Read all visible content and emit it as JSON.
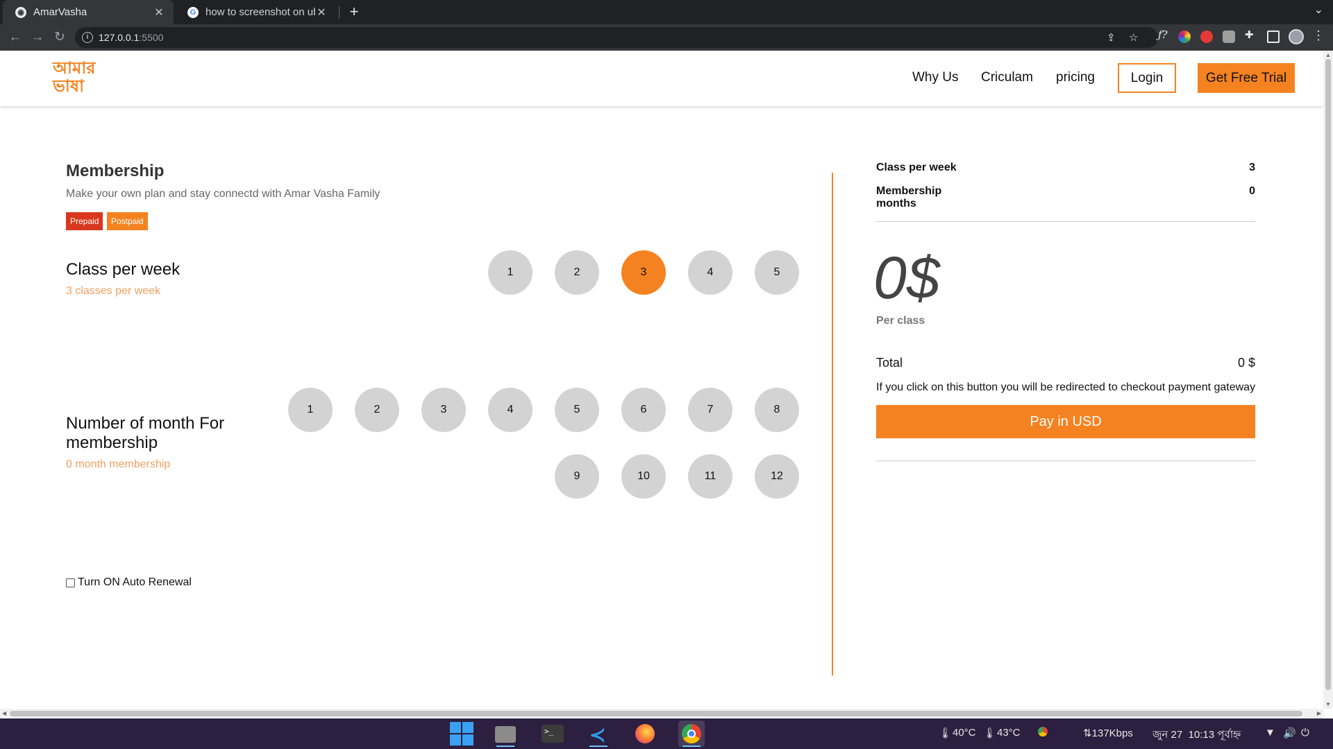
{
  "browser": {
    "tabs": [
      {
        "title": "AmarVasha",
        "active": true
      },
      {
        "title": "how to screenshot on ubu",
        "active": false
      }
    ],
    "new_tab": "+",
    "url_host": "127.0.0.1",
    "url_port": ":5500"
  },
  "header": {
    "logo_line1": "আমার",
    "logo_line2": "ভাষা",
    "nav": [
      "Why Us",
      "Criculam",
      "pricing"
    ],
    "login_label": "Login",
    "trial_label": "Get Free Trial"
  },
  "membership": {
    "title": "Membership",
    "subtitle": "Make your own plan and stay connectd with Amar Vasha Family",
    "badges": [
      "Prepaid",
      "Postpaid"
    ],
    "class_section": {
      "title": "Class per week",
      "hint": "3 classes per week",
      "options": [
        "1",
        "2",
        "3",
        "4",
        "5"
      ],
      "selected": "3"
    },
    "month_section": {
      "title_line1": "Number of month For",
      "title_line2": "membership",
      "hint": "0 month membership",
      "options": [
        "1",
        "2",
        "3",
        "4",
        "5",
        "6",
        "7",
        "8",
        "9",
        "10",
        "11",
        "12"
      ],
      "selected": null
    },
    "auto_renewal_label": "Turn ON Auto Renewal",
    "auto_renewal_checked": false
  },
  "summary": {
    "class_label": "Class per week",
    "class_value": "3",
    "months_label_line1": "Membership",
    "months_label_line2": "months",
    "months_value": "0",
    "price": "0$",
    "price_unit": "Per class",
    "total_label": "Total",
    "total_value": "0 $",
    "redirect_note": "If you click on this button you will be redirected to checkout payment gateway",
    "pay_label": "Pay in USD"
  },
  "taskbar": {
    "temp1": "40°C",
    "temp2": "43°C",
    "network": "⇅137Kbps",
    "date": "জুন 27",
    "time": "10:13 পূর্বাহ্ন"
  },
  "colors": {
    "accent": "#f58220",
    "prepaid": "#d9381e",
    "circle": "#d3d3d3"
  }
}
